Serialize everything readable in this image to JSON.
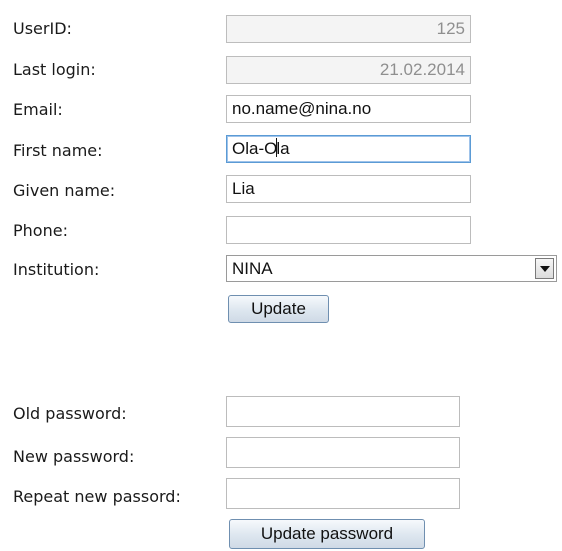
{
  "profile": {
    "userid": {
      "label": "UserID:",
      "value": "125"
    },
    "last_login": {
      "label": "Last login:",
      "value": "21.02.2014"
    },
    "email": {
      "label": "Email:",
      "value": "no.name@nina.no"
    },
    "first_name": {
      "label": "First name:",
      "value_before_caret": "Ola-O",
      "value_after_caret": "la"
    },
    "given_name": {
      "label": "Given name:",
      "value": "Lia"
    },
    "phone": {
      "label": "Phone:",
      "value": ""
    },
    "institution": {
      "label": "Institution:",
      "selected": "NINA"
    },
    "update_label": "Update"
  },
  "password": {
    "old": {
      "label": "Old password:",
      "value": ""
    },
    "new": {
      "label": "New password:",
      "value": ""
    },
    "repeat": {
      "label": "Repeat new passord:",
      "value": ""
    },
    "update_label": "Update password"
  }
}
